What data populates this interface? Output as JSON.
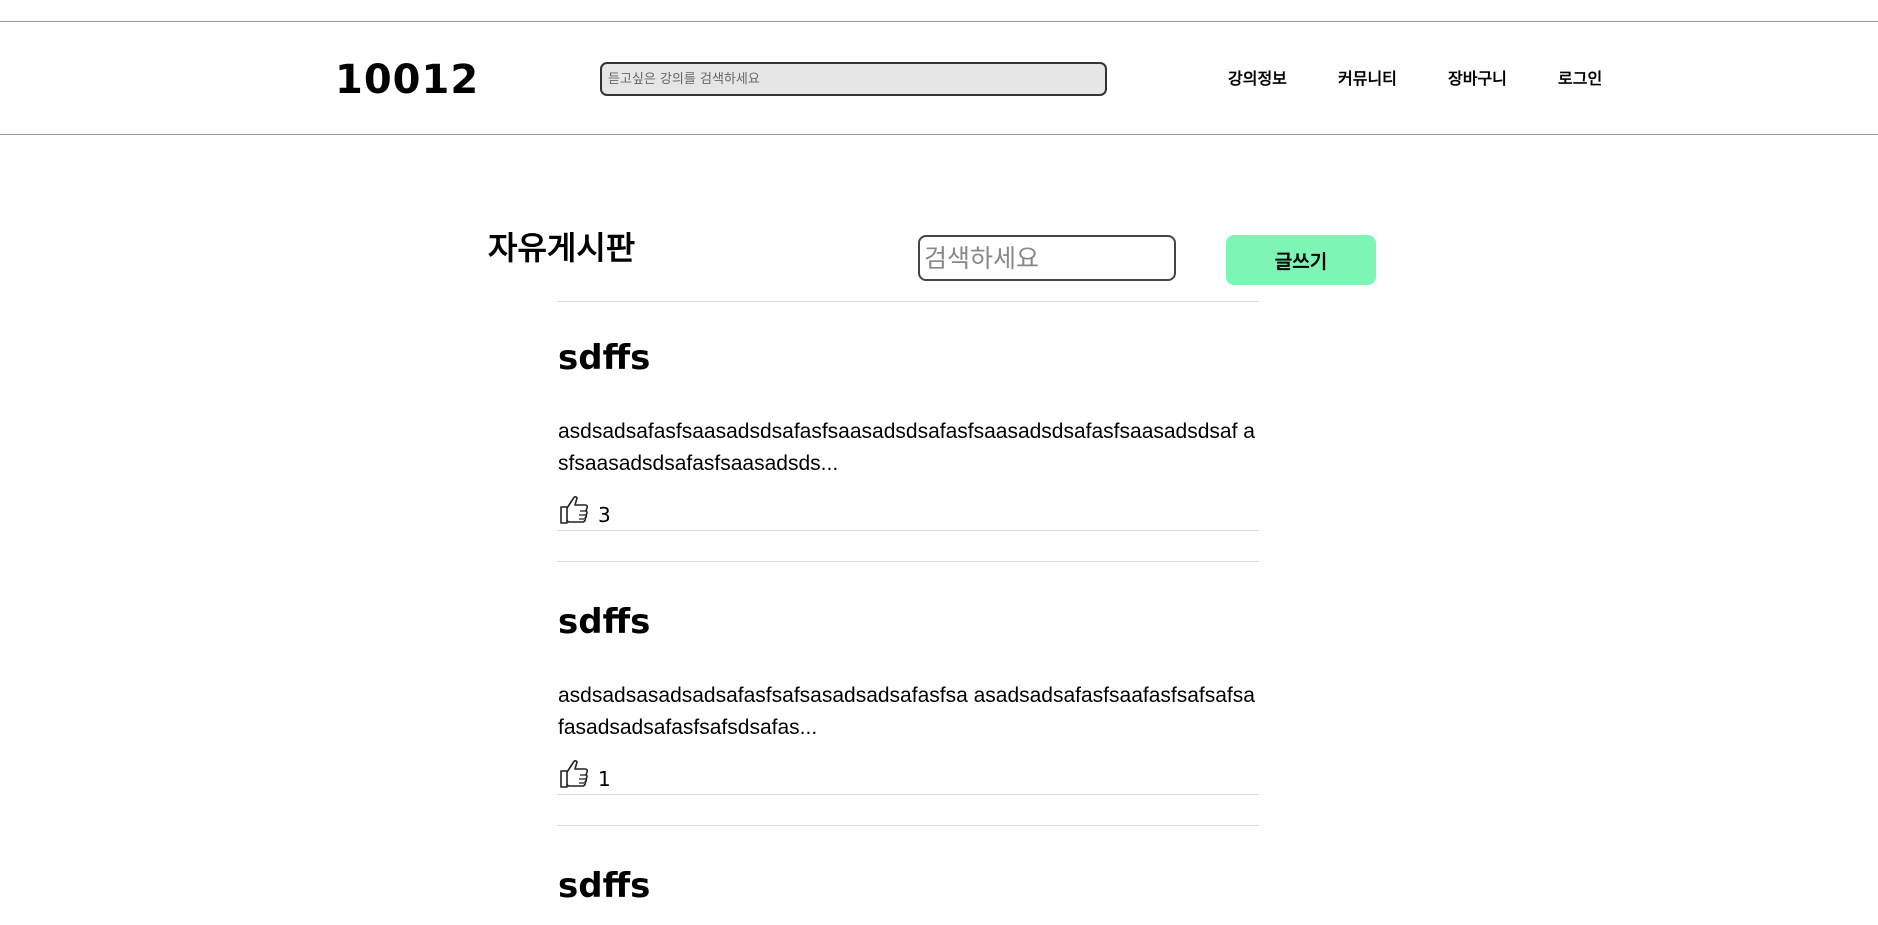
{
  "header": {
    "logo": "10012",
    "search_placeholder": "듣고싶은 강의를 검색하세요",
    "nav": [
      "강의정보",
      "커뮤니티",
      "장바구니",
      "로그인"
    ]
  },
  "board": {
    "title": "자유게시판",
    "search_placeholder": "검색하세요",
    "write_label": "글쓰기"
  },
  "posts": [
    {
      "title": "sdffs",
      "body": "asdsadsafasfsaasadsdsafasfsaasadsdsafasfsaasadsdsafasfsaasadsdsaf asfsaasadsdsafasfsaasadsds...",
      "likes": "3"
    },
    {
      "title": "sdffs",
      "body": "asdsadsasadsadsafasfsafsasadsadsafasfsa asadsadsafasfsaafasfsafsafsafasadsadsafasfsafsdsafas...",
      "likes": "1"
    },
    {
      "title": "sdffs",
      "body": "",
      "likes": ""
    }
  ],
  "colors": {
    "write_button": "#7cf5b5",
    "rule": "#9a9a9a",
    "list_rule": "#dcdcdc",
    "header_search_bg": "#e6e6e6"
  },
  "icons": {
    "like": "thumbs-up-icon"
  }
}
